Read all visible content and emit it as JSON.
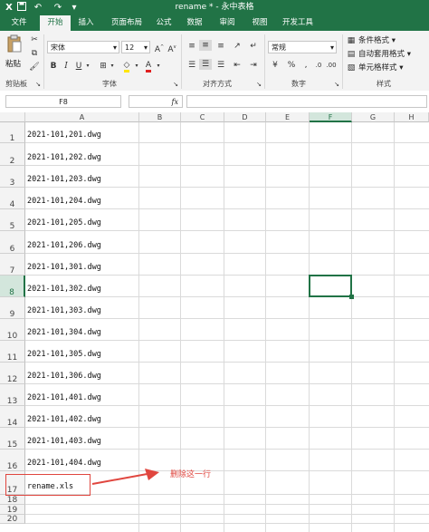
{
  "window": {
    "title": "rename * - 永中表格",
    "qat_icons": [
      "excel-logo-icon",
      "save-icon",
      "undo-icon",
      "redo-icon",
      "customize-icon"
    ]
  },
  "tabs": [
    "文件",
    "开始",
    "插入",
    "页面布局",
    "公式",
    "数据",
    "审阅",
    "视图",
    "开发工具"
  ],
  "active_tab": "开始",
  "ribbon": {
    "clipboard": {
      "paste_label": "粘贴",
      "group_label": "剪贴板"
    },
    "font": {
      "font_name": "宋体",
      "font_size": "12",
      "group_label": "字体"
    },
    "alignment": {
      "group_label": "对齐方式"
    },
    "number": {
      "format": "常规",
      "group_label": "数字"
    },
    "styles": {
      "conditional_format": "条件格式",
      "table_format": "自动套用格式",
      "cell_styles": "单元格样式",
      "group_label": "样式"
    }
  },
  "formula_bar": {
    "name_box": "F8",
    "fx": "fx",
    "value": ""
  },
  "columns": [
    "A",
    "B",
    "C",
    "D",
    "E",
    "F",
    "G",
    "H"
  ],
  "rows": [
    "1",
    "2",
    "3",
    "4",
    "5",
    "6",
    "7",
    "8",
    "9",
    "10",
    "11",
    "12",
    "13",
    "14",
    "15",
    "16",
    "17",
    "18",
    "19",
    "20"
  ],
  "cells_a": [
    "2021-101,201.dwg",
    "2021-101,202.dwg",
    "2021-101,203.dwg",
    "2021-101,204.dwg",
    "2021-101,205.dwg",
    "2021-101,206.dwg",
    "2021-101,301.dwg",
    "2021-101,302.dwg",
    "2021-101,303.dwg",
    "2021-101,304.dwg",
    "2021-101,305.dwg",
    "2021-101,306.dwg",
    "2021-101,401.dwg",
    "2021-101,402.dwg",
    "2021-101,403.dwg",
    "2021-101,404.dwg",
    "rename.xls",
    "",
    "",
    ""
  ],
  "annotation": {
    "text": "删除这一行",
    "color": "#e0463f"
  },
  "colors": {
    "accent": "#217346",
    "annotation": "#e0463f"
  }
}
